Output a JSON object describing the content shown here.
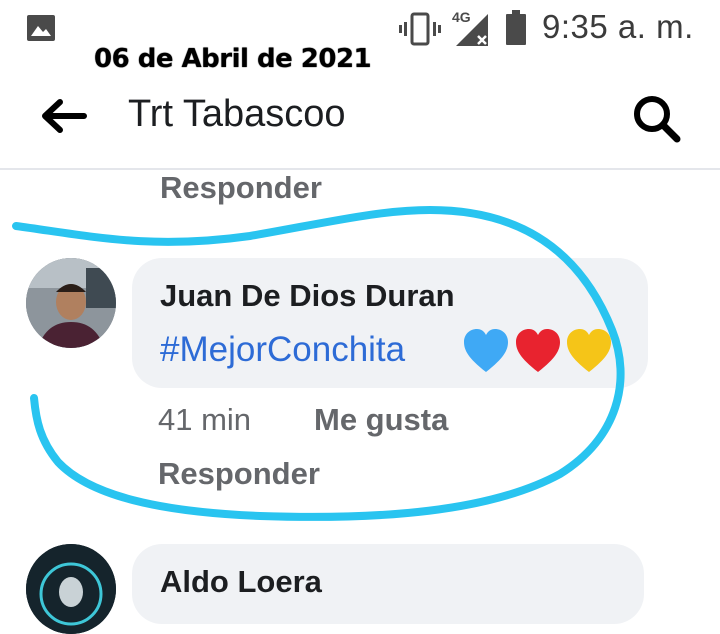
{
  "status_bar": {
    "network": "4G",
    "time": "9:35 a. m.",
    "icons": [
      "gallery-icon",
      "vibrate-icon",
      "signal-icon",
      "battery-icon"
    ]
  },
  "overlay": {
    "date": "06 de Abril de 2021"
  },
  "header": {
    "title": "Trt Tabascoo",
    "icons": [
      "back-arrow-icon",
      "search-icon"
    ]
  },
  "comments": [
    {
      "reply_label": "Responder"
    },
    {
      "author": "Juan De Dios Duran",
      "text": "#MejorConchita",
      "emojis": [
        "blue-heart",
        "red-heart",
        "yellow-heart"
      ],
      "time": "41 min",
      "like_label": "Me gusta",
      "reply_label": "Responder"
    },
    {
      "author": "Aldo Loera"
    }
  ],
  "colors": {
    "link_blue": "#2d6bd6",
    "meta_gray": "#65676b",
    "bubble_bg": "#f0f2f5",
    "annotation_stroke": "#29c4f0"
  }
}
